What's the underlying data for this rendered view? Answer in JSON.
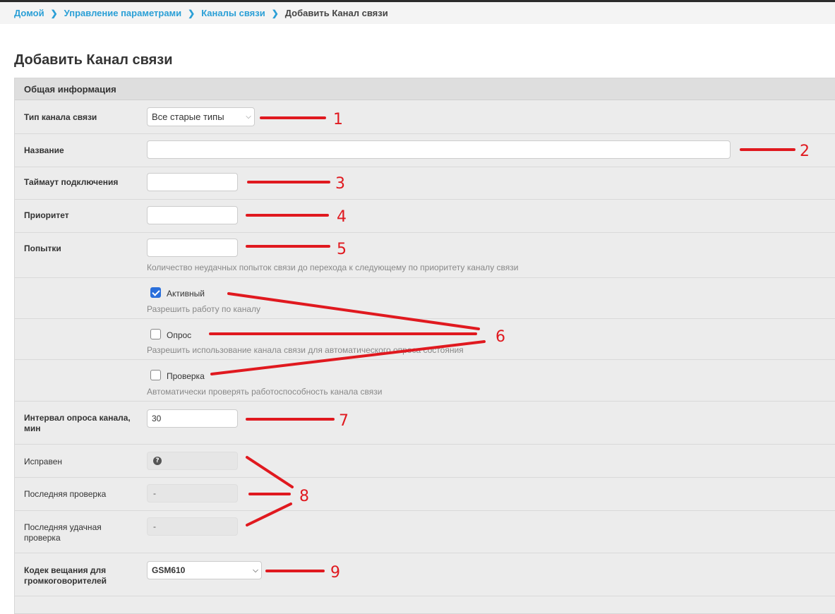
{
  "breadcrumb": {
    "items": [
      "Домой",
      "Управление параметрами",
      "Каналы связи"
    ],
    "current": "Добавить Канал связи"
  },
  "page_title": "Добавить Канал связи",
  "panel": {
    "heading": "Общая информация",
    "channel_type": {
      "label": "Тип канала связи",
      "value": "Все старые типы"
    },
    "name": {
      "label": "Название",
      "value": ""
    },
    "timeout": {
      "label": "Таймаут подключения",
      "value": ""
    },
    "priority": {
      "label": "Приоритет",
      "value": ""
    },
    "attempts": {
      "label": "Попытки",
      "value": "",
      "help": "Количество неудачных попыток связи до перехода к следующему по приоритету каналу связи"
    },
    "active": {
      "label": "Активный",
      "checked": true,
      "help": "Разрешить работу по каналу"
    },
    "polling": {
      "label": "Опрос",
      "checked": false,
      "help": "Разрешить использование канала связи для автоматического опроса состояния"
    },
    "check": {
      "label": "Проверка",
      "checked": false,
      "help": "Автоматически проверять работоспособность канала связи"
    },
    "poll_interval": {
      "label": "Интервал опроса канала, мин",
      "value": "30"
    },
    "healthy": {
      "label": "Исправен",
      "icon": "question-circle-icon"
    },
    "last_check": {
      "label": "Последняя проверка",
      "value": "-"
    },
    "last_success_check": {
      "label": "Последняя удачная проверка",
      "value": "-"
    },
    "codec": {
      "label": "Кодек вещания для громкоговорителей",
      "value": "GSM610"
    }
  },
  "annotations": [
    "1",
    "2",
    "3",
    "4",
    "5",
    "6",
    "7",
    "8",
    "9"
  ],
  "annotation_color": "#e0191f",
  "link_color": "#2a9fd6"
}
